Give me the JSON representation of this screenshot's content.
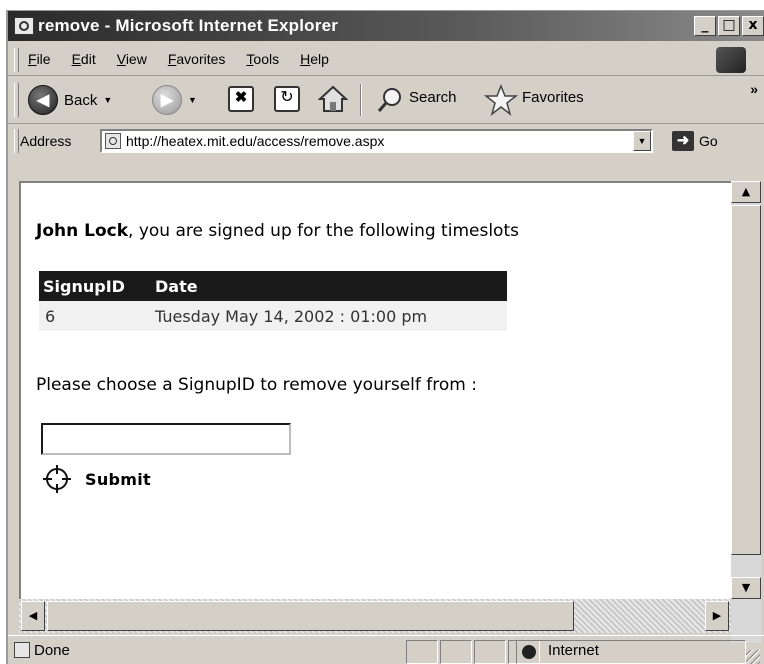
{
  "window": {
    "title": "remove - Microsoft Internet Explorer",
    "minimize": "_",
    "maximize": "□",
    "close": "x"
  },
  "menu": {
    "items": [
      "File",
      "Edit",
      "View",
      "Favorites",
      "Tools",
      "Help"
    ]
  },
  "toolbar": {
    "back_label": "Back",
    "search_label": "Search",
    "favorites_label": "Favorites",
    "overflow": "»"
  },
  "address": {
    "label": "Address",
    "url": "http://heatex.mit.edu/access/remove.aspx",
    "go_label": "Go"
  },
  "page": {
    "user_name": "John Lock",
    "greeting_suffix": ", you are signed up for the following timeslots",
    "table": {
      "headers": [
        "SignupID",
        "Date"
      ],
      "rows": [
        {
          "id": "6",
          "date": "Tuesday May 14, 2002 : 01:00 pm"
        }
      ]
    },
    "instruction": "Please choose a SignupID to remove yourself from :",
    "input_value": "",
    "submit_label": "Submit"
  },
  "status": {
    "text": "Done",
    "zone": "Internet"
  },
  "icons": [
    "ie-page-icon",
    "back-arrow-icon",
    "forward-arrow-icon",
    "stop-icon",
    "refresh-icon",
    "home-icon",
    "search-icon",
    "favorites-star-icon",
    "go-arrow-icon",
    "crosshair-icon",
    "globe-icon"
  ]
}
